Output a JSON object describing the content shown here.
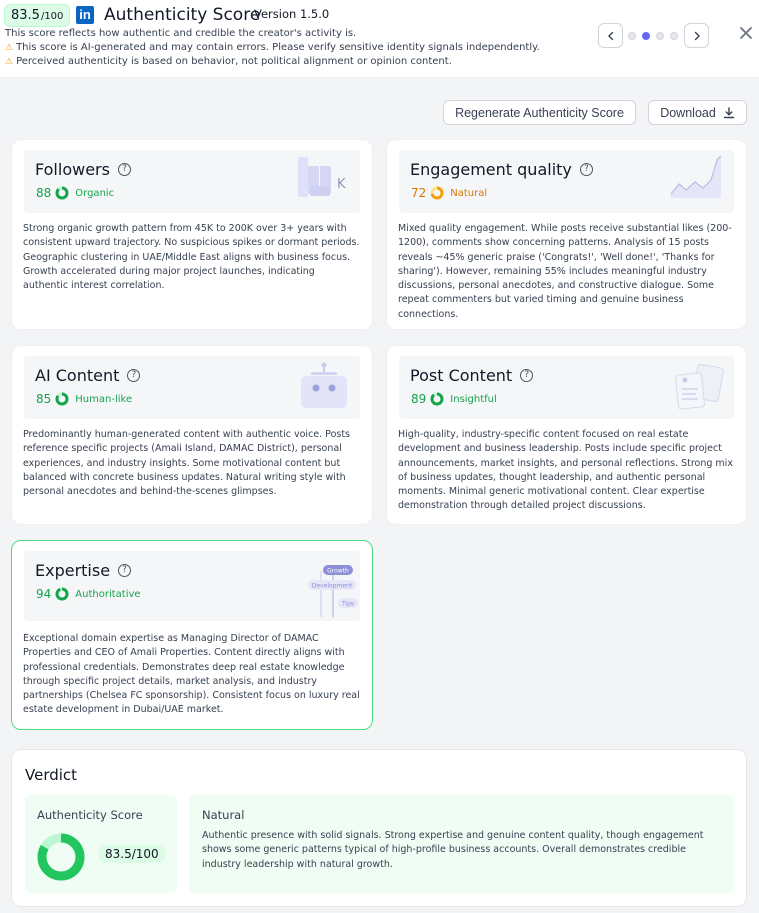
{
  "header": {
    "score_main": "83.5",
    "score_suffix": "/100",
    "logo_text": "in",
    "title": "Authenticity Score",
    "version": "Version 1.5.0",
    "subtitle": "This score reflects how authentic and credible the creator's activity is.",
    "warnings": [
      "This score is AI-generated and may contain errors. Please verify sensitive identity signals independently.",
      "Perceived authenticity is based on behavior, not political alignment or opinion content."
    ],
    "pagination": {
      "total": 4,
      "active": 2
    }
  },
  "actions": {
    "regenerate_label": "Regenerate Authenticity Score",
    "download_label": "Download"
  },
  "cards": [
    {
      "title": "Followers",
      "score": 88,
      "label": "Organic",
      "status_color": "#16a34a",
      "illustration": "bar-k-icon",
      "text": "Strong organic growth pattern from 45K to 200K over 3+ years with consistent upward trajectory. No suspicious spikes or dormant periods. Geographic clustering in UAE/Middle East aligns with business focus. Growth accelerated during major project launches, indicating authentic interest correlation."
    },
    {
      "title": "Engagement quality",
      "score": 72,
      "label": "Natural",
      "status_color": "#d97706",
      "illustration": "area-chart-icon",
      "text": "Mixed quality engagement. While posts receive substantial likes (200-1200), comments show concerning patterns. Analysis of 15 posts reveals ~45% generic praise ('Congrats!', 'Well done!', 'Thanks for sharing'). However, remaining 55% includes meaningful industry discussions, personal anecdotes, and constructive dialogue. Some repeat commenters but varied timing and genuine business connections."
    },
    {
      "title": "AI Content",
      "score": 85,
      "label": "Human-like",
      "status_color": "#16a34a",
      "illustration": "robot-icon",
      "text": "Predominantly human-generated content with authentic voice. Posts reference specific projects (Amali Island, DAMAC District), personal experiences, and industry insights. Some motivational content but balanced with concrete business updates. Natural writing style with personal anecdotes and behind-the-scenes glimpses."
    },
    {
      "title": "Post Content",
      "score": 89,
      "label": "Insightful",
      "status_color": "#16a34a",
      "illustration": "documents-icon",
      "text": "High-quality, industry-specific content focused on real estate development and business leadership. Posts include specific project announcements, market insights, and personal reflections. Strong mix of business updates, thought leadership, and authentic personal moments. Minimal generic motivational content. Clear expertise demonstration through detailed project discussions."
    },
    {
      "title": "Expertise",
      "score": 94,
      "label": "Authoritative",
      "status_color": "#16a34a",
      "illustration": "skill-tree-icon",
      "illustration_labels": [
        "Growth",
        "Development",
        "Tips"
      ],
      "text": "Exceptional domain expertise as Managing Director of DAMAC Properties and CEO of Amali Properties. Content directly aligns with professional credentials. Demonstrates deep real estate knowledge through specific project details, market analysis, and industry partnerships (Chelsea FC sponsorship). Consistent focus on luxury real estate development in Dubai/UAE market."
    }
  ],
  "verdict": {
    "title": "Verdict",
    "score_label": "Authenticity Score",
    "score_value": "83.5/100",
    "score_fraction": 0.835,
    "rating": "Natural",
    "summary": "Authentic presence with solid signals. Strong expertise and genuine content quality, though engagement shows some generic patterns typical of high-profile business accounts. Overall demonstrates credible industry leadership with natural growth."
  }
}
